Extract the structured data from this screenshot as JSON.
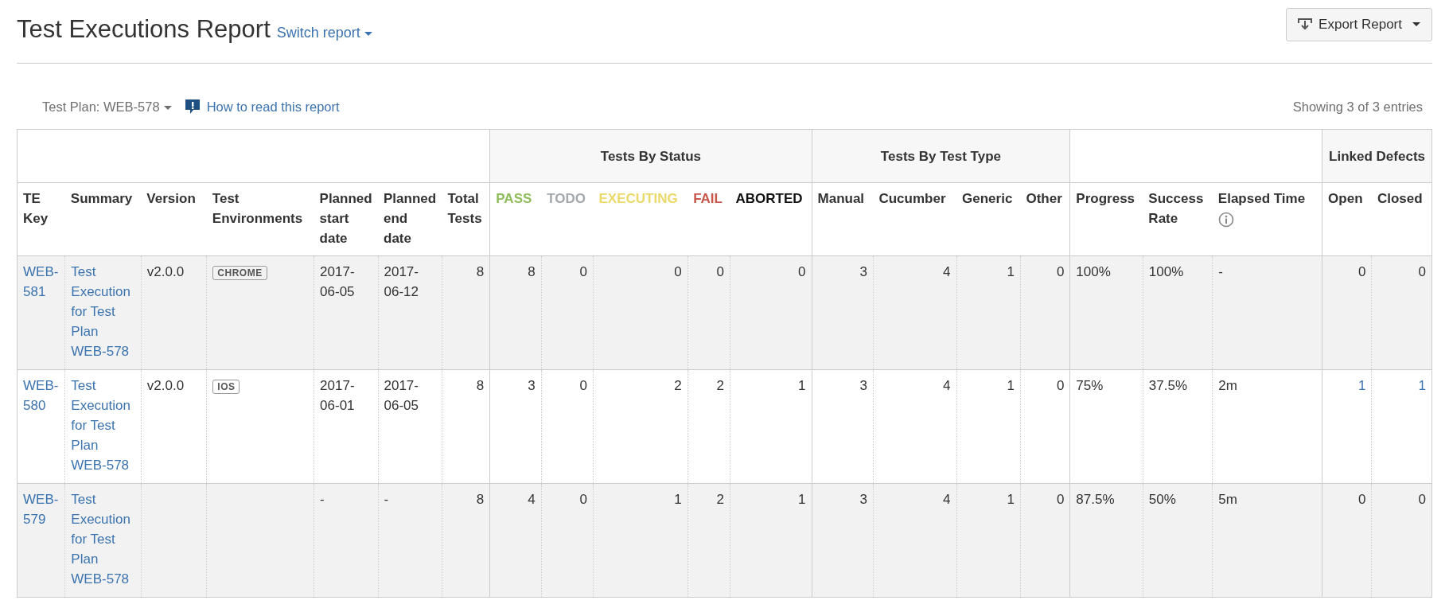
{
  "header": {
    "title": "Test Executions Report",
    "switch_label": "Switch report",
    "export_label": "Export Report"
  },
  "toolbar": {
    "test_plan": "Test Plan: WEB-578",
    "help_link": "How to read this report",
    "entries": "Showing 3 of 3 entries"
  },
  "table": {
    "groups": [
      {
        "columns": [
          {
            "label": "TE Key",
            "kind": "text"
          },
          {
            "label": "Summary",
            "kind": "text"
          },
          {
            "label": "Version",
            "kind": "text"
          },
          {
            "label": "Test Environments",
            "kind": "text"
          },
          {
            "label": "Planned start date",
            "kind": "text"
          },
          {
            "label": "Planned end date",
            "kind": "text"
          },
          {
            "label": "Total Tests",
            "kind": "number"
          }
        ]
      },
      {
        "label": "Tests By Status",
        "columns": [
          {
            "label": "PASS",
            "kind": "number",
            "color": "#8fbd5a"
          },
          {
            "label": "TODO",
            "kind": "number",
            "color": "#a3a8ad"
          },
          {
            "label": "EXECUTING",
            "kind": "number",
            "color": "#ebd96a"
          },
          {
            "label": "FAIL",
            "kind": "number",
            "color": "#c9574b"
          },
          {
            "label": "ABORTED",
            "kind": "number",
            "color": "#111111"
          }
        ]
      },
      {
        "label": "Tests By Test Type",
        "columns": [
          {
            "label": "Manual",
            "kind": "number"
          },
          {
            "label": "Cucumber",
            "kind": "number"
          },
          {
            "label": "Generic",
            "kind": "number"
          },
          {
            "label": "Other",
            "kind": "number"
          }
        ]
      },
      {
        "columns": [
          {
            "label": "Progress",
            "kind": "text"
          },
          {
            "label": "Success Rate",
            "kind": "text"
          },
          {
            "label": "Elapsed Time",
            "kind": "text",
            "info": true
          }
        ]
      },
      {
        "label": "Linked Defects",
        "columns": [
          {
            "label": "Open",
            "kind": "number"
          },
          {
            "label": "Closed",
            "kind": "number"
          }
        ]
      }
    ],
    "rows": [
      {
        "shaded": true,
        "cells": [
          {
            "text": "WEB-581",
            "kind": "link"
          },
          {
            "text": "Test Execution for Test Plan WEB-578",
            "kind": "link"
          },
          {
            "text": "v2.0.0",
            "kind": "text"
          },
          {
            "text": "CHROME",
            "kind": "tag"
          },
          {
            "text": "2017-06-05",
            "kind": "text"
          },
          {
            "text": "2017-06-12",
            "kind": "text"
          },
          {
            "text": "8",
            "kind": "text"
          },
          {
            "text": "8",
            "kind": "text"
          },
          {
            "text": "0",
            "kind": "text"
          },
          {
            "text": "0",
            "kind": "text"
          },
          {
            "text": "0",
            "kind": "text"
          },
          {
            "text": "0",
            "kind": "text"
          },
          {
            "text": "3",
            "kind": "text"
          },
          {
            "text": "4",
            "kind": "text"
          },
          {
            "text": "1",
            "kind": "text"
          },
          {
            "text": "0",
            "kind": "text"
          },
          {
            "text": "100%",
            "kind": "text"
          },
          {
            "text": "100%",
            "kind": "text"
          },
          {
            "text": "-",
            "kind": "text"
          },
          {
            "text": "0",
            "kind": "text"
          },
          {
            "text": "0",
            "kind": "text"
          }
        ]
      },
      {
        "shaded": false,
        "cells": [
          {
            "text": "WEB-580",
            "kind": "link"
          },
          {
            "text": "Test Execution for Test Plan WEB-578",
            "kind": "link"
          },
          {
            "text": "v2.0.0",
            "kind": "text"
          },
          {
            "text": "IOS",
            "kind": "tag"
          },
          {
            "text": "2017-06-01",
            "kind": "text"
          },
          {
            "text": "2017-06-05",
            "kind": "text"
          },
          {
            "text": "8",
            "kind": "text"
          },
          {
            "text": "3",
            "kind": "text"
          },
          {
            "text": "0",
            "kind": "text"
          },
          {
            "text": "2",
            "kind": "text"
          },
          {
            "text": "2",
            "kind": "text"
          },
          {
            "text": "1",
            "kind": "text"
          },
          {
            "text": "3",
            "kind": "text"
          },
          {
            "text": "4",
            "kind": "text"
          },
          {
            "text": "1",
            "kind": "text"
          },
          {
            "text": "0",
            "kind": "text"
          },
          {
            "text": "75%",
            "kind": "text"
          },
          {
            "text": "37.5%",
            "kind": "text"
          },
          {
            "text": "2m",
            "kind": "text"
          },
          {
            "text": "1",
            "kind": "link"
          },
          {
            "text": "1",
            "kind": "link"
          }
        ]
      },
      {
        "shaded": true,
        "cells": [
          {
            "text": "WEB-579",
            "kind": "link"
          },
          {
            "text": "Test Execution for Test Plan WEB-578",
            "kind": "link"
          },
          {
            "kind": "empty"
          },
          {
            "kind": "empty"
          },
          {
            "text": "-",
            "kind": "text"
          },
          {
            "text": "-",
            "kind": "text"
          },
          {
            "text": "8",
            "kind": "text"
          },
          {
            "text": "4",
            "kind": "text"
          },
          {
            "text": "0",
            "kind": "text"
          },
          {
            "text": "1",
            "kind": "text"
          },
          {
            "text": "2",
            "kind": "text"
          },
          {
            "text": "1",
            "kind": "text"
          },
          {
            "text": "3",
            "kind": "text"
          },
          {
            "text": "4",
            "kind": "text"
          },
          {
            "text": "1",
            "kind": "text"
          },
          {
            "text": "0",
            "kind": "text"
          },
          {
            "text": "87.5%",
            "kind": "text"
          },
          {
            "text": "50%",
            "kind": "text"
          },
          {
            "text": "5m",
            "kind": "text"
          },
          {
            "text": "0",
            "kind": "text"
          },
          {
            "text": "0",
            "kind": "text"
          }
        ]
      }
    ]
  }
}
